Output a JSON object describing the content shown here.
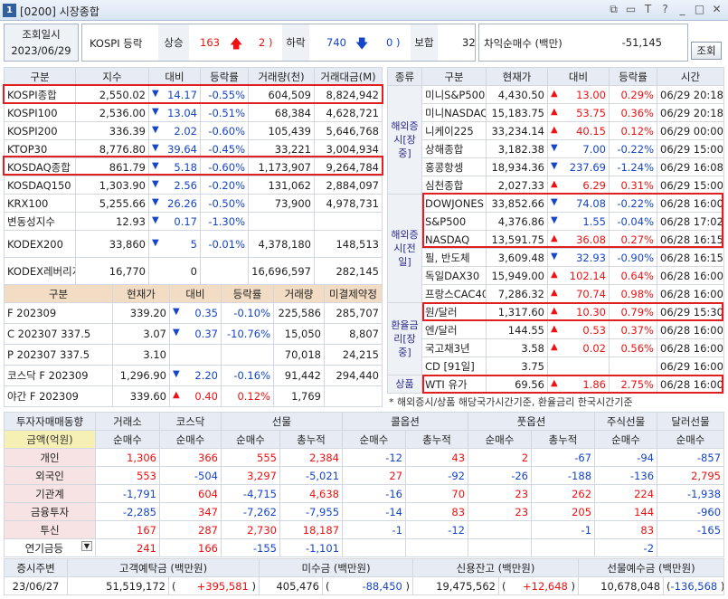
{
  "window": {
    "number": "1",
    "title": "[0200] 시장종합"
  },
  "header": {
    "date_label": "조회일시",
    "date": "2023/06/29",
    "index_name": "KOSPI 등락",
    "up_label": "상승",
    "up_count": "163",
    "up_limit": "2",
    "down_label": "하락",
    "down_count": "740",
    "down_limit": "0",
    "flat_label": "보합",
    "flat_count": "32",
    "arb_label": "차익순매수 (백만)",
    "arb_value": "-51,145",
    "query_button": "조회"
  },
  "indices": {
    "headers": [
      "구분",
      "지수",
      "대비",
      "등락률",
      "거래량(천)",
      "거래대금(M)"
    ],
    "rows": [
      [
        "KOSPI종합",
        "2,550.02",
        "dn",
        "14.17",
        "-0.55%",
        "604,509",
        "8,824,942"
      ],
      [
        "KOSPI100",
        "2,536.00",
        "dn",
        "13.04",
        "-0.51%",
        "68,384",
        "4,628,721"
      ],
      [
        "KOSPI200",
        "336.39",
        "dn",
        "2.02",
        "-0.60%",
        "105,439",
        "5,646,768"
      ],
      [
        "KTOP30",
        "8,776.80",
        "dn",
        "39.64",
        "-0.45%",
        "33,221",
        "3,004,934"
      ],
      [
        "KOSDAQ종합",
        "861.79",
        "dn",
        "5.18",
        "-0.60%",
        "1,173,907",
        "9,264,784"
      ],
      [
        "KOSDAQ150",
        "1,303.90",
        "dn",
        "2.56",
        "-0.20%",
        "131,062",
        "2,884,097"
      ],
      [
        "KRX100",
        "5,255.66",
        "dn",
        "26.26",
        "-0.50%",
        "73,900",
        "4,978,731"
      ],
      [
        "변동성지수",
        "12.93",
        "dn",
        "0.17",
        "-1.30%",
        "",
        ""
      ],
      [
        "KODEX200",
        "33,860",
        "dn",
        "5",
        "-0.01%",
        "4,378,180",
        "148,513"
      ],
      [
        "KODEX레버리지",
        "16,770",
        "",
        "0",
        "",
        "16,696,597",
        "282,145"
      ]
    ]
  },
  "futures": {
    "headers": [
      "구분",
      "현재가",
      "대비",
      "등락률",
      "거래량",
      "미결제약정"
    ],
    "rows": [
      [
        "F 202309",
        "339.20",
        "dn",
        "0.35",
        "-0.10%",
        "225,586",
        "285,707"
      ],
      [
        "C 202307 337.5",
        "3.07",
        "dn",
        "0.37",
        "-10.76%",
        "15,050",
        "8,807"
      ],
      [
        "P 202307 337.5",
        "3.10",
        "",
        "",
        "",
        "70,018",
        "24,215"
      ],
      [
        "코스닥 F 202309",
        "1,296.90",
        "dn",
        "2.20",
        "-0.16%",
        "91,442",
        "294,440"
      ],
      [
        "야간  F 202309",
        "339.60",
        "up",
        "0.40",
        "0.12%",
        "1,769",
        ""
      ]
    ]
  },
  "overseas": {
    "headers": [
      "종류",
      "구분",
      "현재가",
      "대비",
      "등락률",
      "시간"
    ],
    "groups": [
      {
        "name": "해외증시[장중]",
        "rows": [
          [
            "미니S&P500",
            "4,430.50",
            "up",
            "13.00",
            "0.29%",
            "06/29 20:18"
          ],
          [
            "미니NASDAQ",
            "15,183.75",
            "up",
            "53.75",
            "0.36%",
            "06/29 20:18"
          ],
          [
            "니케이225",
            "33,234.14",
            "up",
            "40.15",
            "0.12%",
            "06/29 00:00"
          ],
          [
            "상해종합",
            "3,182.38",
            "dn",
            "7.00",
            "-0.22%",
            "06/29 15:00"
          ],
          [
            "홍콩항셍",
            "18,934.36",
            "dn",
            "237.69",
            "-1.24%",
            "06/29 16:08"
          ],
          [
            "심천종합",
            "2,027.33",
            "up",
            "6.29",
            "0.31%",
            "06/29 15:00"
          ]
        ]
      },
      {
        "name": "해외증시[전일]",
        "rows": [
          [
            "DOWJONES",
            "33,852.66",
            "dn",
            "74.08",
            "-0.22%",
            "06/28 16:00"
          ],
          [
            "S&P500",
            "4,376.86",
            "dn",
            "1.55",
            "-0.04%",
            "06/28 17:02"
          ],
          [
            "NASDAQ",
            "13,591.75",
            "up",
            "36.08",
            "0.27%",
            "06/28 16:15"
          ],
          [
            "필, 반도체",
            "3,609.48",
            "dn",
            "32.93",
            "-0.90%",
            "06/28 16:15"
          ],
          [
            "독일DAX30",
            "15,949.00",
            "up",
            "102.14",
            "0.64%",
            "06/28 16:00"
          ],
          [
            "프랑스CAC40",
            "7,286.32",
            "up",
            "70.74",
            "0.98%",
            "06/28 16:00"
          ]
        ]
      },
      {
        "name": "환율금리[장중]",
        "rows": [
          [
            "원/달러",
            "1,317.60",
            "up",
            "10.30",
            "0.79%",
            "06/29 15:30"
          ],
          [
            "엔/달러",
            "144.55",
            "up",
            "0.53",
            "0.37%",
            "06/28 16:00"
          ],
          [
            "국고채3년",
            "3.58",
            "up",
            "0.02",
            "0.56%",
            "06/28 16:00"
          ],
          [
            "CD [91일]",
            "3.75",
            "",
            "",
            "",
            "06/29 16:00"
          ]
        ]
      },
      {
        "name": "상품",
        "rows": [
          [
            "WTI 유가",
            "69.56",
            "up",
            "1.86",
            "2.75%",
            "06/28 16:00"
          ]
        ]
      }
    ],
    "note": "* 해외증시/상품 해당국가시간기준, 환율금리 한국시간기준"
  },
  "investors": {
    "title": "투자자매매동향",
    "unit_label": "금액(억원)",
    "cols": [
      "거래소",
      "코스닥",
      "선물",
      "콜옵션",
      "풋옵션",
      "주식선물",
      "달러선물"
    ],
    "sub": [
      "순매수",
      "순매수",
      "순매수",
      "총누적",
      "순매수",
      "총누적",
      "순매수",
      "총누적",
      "순매수",
      "순매수"
    ],
    "rows": [
      [
        "개인",
        "1,306",
        "366",
        "555",
        "2,384",
        "-12",
        "43",
        "2",
        "-67",
        "-94",
        "-857"
      ],
      [
        "외국인",
        "553",
        "-504",
        "3,297",
        "-5,021",
        "27",
        "-92",
        "-26",
        "-188",
        "-136",
        "2,795"
      ],
      [
        "기관계",
        "-1,791",
        "604",
        "-4,715",
        "4,638",
        "-16",
        "70",
        "23",
        "262",
        "224",
        "-1,938"
      ],
      [
        "금융투자",
        "-2,285",
        "347",
        "-7,262",
        "-7,955",
        "-14",
        "83",
        "23",
        "205",
        "144",
        "-960"
      ],
      [
        "투신",
        "167",
        "287",
        "2,730",
        "18,187",
        "-1",
        "-12",
        "",
        "-1",
        "83",
        "-165"
      ],
      [
        "연기금등",
        "241",
        "166",
        "-155",
        "-1,101",
        "",
        "",
        "",
        "",
        "-2",
        ""
      ]
    ]
  },
  "bottom": {
    "label": "증시주변",
    "date": "23/06/27",
    "deposit_label": "고객예탁금 (백만원)",
    "deposit": "51,519,172",
    "deposit_chg": "+395,581",
    "receivable_label": "미수금 (백만원)",
    "receivable": "405,476",
    "receivable_chg": "-88,450",
    "credit_label": "신용잔고 (백만원)",
    "credit": "19,475,562",
    "credit_chg": "+12,648",
    "fut_label": "선물예수금 (백만원)",
    "fut": "10,678,048",
    "fut_chg": "-136,568"
  }
}
